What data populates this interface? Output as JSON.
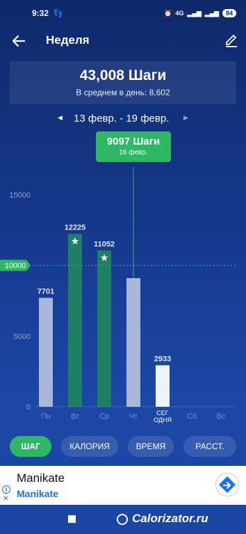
{
  "status": {
    "time": "9:32",
    "battery": "84",
    "network": "4G"
  },
  "header": {
    "title": "Неделя"
  },
  "summary": {
    "total": "43,008 Шаги",
    "avg_label": "В среднем в день:",
    "avg_value": "8,602"
  },
  "week_nav": {
    "range": "13 февр. - 19 февр."
  },
  "tooltip": {
    "steps": "9097 Шаги",
    "date": "16 февр."
  },
  "chart_data": {
    "type": "bar",
    "categories": [
      "Пн",
      "Вт",
      "Ср",
      "Чт",
      "СЕГ ОДНЯ",
      "Сб",
      "Вс"
    ],
    "values": [
      7701,
      12225,
      11052,
      9097,
      2933,
      0,
      0
    ],
    "value_labels": [
      "7701",
      "12225",
      "11052",
      "",
      "2933",
      "",
      ""
    ],
    "goal_reached": [
      false,
      true,
      true,
      false,
      false,
      false,
      false
    ],
    "ylim": [
      0,
      15000
    ],
    "y_ticks": [
      "15000",
      "5000",
      "0"
    ],
    "goal": 10000,
    "goal_label": "10000",
    "colors": {
      "goal_bar": "#1e7f64",
      "normal_bar": "#a9b7d8",
      "today_bar": "#eef2fb",
      "goal_line": "#2eb866"
    }
  },
  "tabs": [
    {
      "label": "ШАГ",
      "active": true
    },
    {
      "label": "КАЛОРИЯ",
      "active": false
    },
    {
      "label": "ВРЕМЯ",
      "active": false
    },
    {
      "label": "РАССТ.",
      "active": false
    }
  ],
  "ad": {
    "title": "Manikate",
    "subtitle": "Manikate"
  },
  "watermark": "Calorizator.ru"
}
